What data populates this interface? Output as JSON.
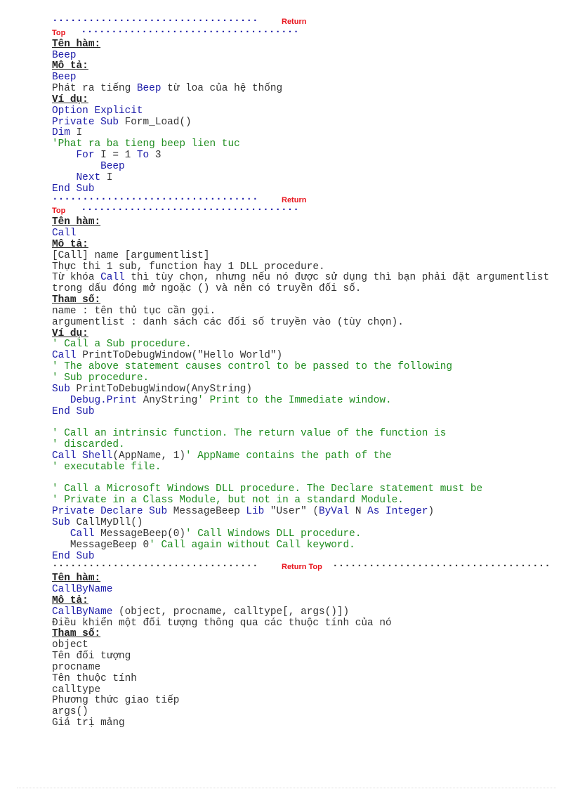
{
  "colors": {
    "keyword": "#1c1ca8",
    "comment": "#1e8c1e",
    "text": "#333333",
    "link": "#e8141c"
  },
  "lines": [
    {
      "type": "sep1",
      "dots": "..................................",
      "link": "Return"
    },
    {
      "type": "sep2",
      "link": "Top",
      "dots": "...................................."
    },
    {
      "segs": [
        {
          "t": "Tên hàm:",
          "c": "h"
        }
      ]
    },
    {
      "segs": [
        {
          "t": "Beep",
          "c": "k"
        }
      ]
    },
    {
      "segs": [
        {
          "t": "Mô tả:",
          "c": "h"
        }
      ]
    },
    {
      "segs": [
        {
          "t": "Beep",
          "c": "k"
        }
      ]
    },
    {
      "segs": [
        {
          "t": "Phát ra tiếng ",
          "c": "n"
        },
        {
          "t": "Beep",
          "c": "k"
        },
        {
          "t": " từ loa của hệ thống",
          "c": "n"
        }
      ]
    },
    {
      "segs": [
        {
          "t": "Ví dụ:",
          "c": "h"
        }
      ]
    },
    {
      "segs": [
        {
          "t": "Option Explicit",
          "c": "k"
        }
      ]
    },
    {
      "segs": [
        {
          "t": "Private Sub ",
          "c": "k"
        },
        {
          "t": "Form_Load()",
          "c": "n"
        }
      ]
    },
    {
      "segs": [
        {
          "t": "Dim ",
          "c": "k"
        },
        {
          "t": "I",
          "c": "n"
        }
      ]
    },
    {
      "segs": [
        {
          "t": "'Phat ra ba tieng beep lien tuc",
          "c": "g"
        }
      ]
    },
    {
      "indent": "    ",
      "segs": [
        {
          "t": "For ",
          "c": "k"
        },
        {
          "t": "I = 1 ",
          "c": "n"
        },
        {
          "t": "To ",
          "c": "k"
        },
        {
          "t": "3",
          "c": "n"
        }
      ]
    },
    {
      "indent": "        ",
      "segs": [
        {
          "t": "Beep",
          "c": "k"
        }
      ]
    },
    {
      "indent": "    ",
      "segs": [
        {
          "t": "Next ",
          "c": "k"
        },
        {
          "t": "I",
          "c": "n"
        }
      ]
    },
    {
      "segs": [
        {
          "t": "End Sub",
          "c": "k"
        }
      ]
    },
    {
      "type": "sep1",
      "dots": "..................................",
      "link": "Return"
    },
    {
      "type": "sep2",
      "link": "Top",
      "dots": "...................................."
    },
    {
      "segs": [
        {
          "t": "Tên hàm:",
          "c": "h"
        }
      ]
    },
    {
      "segs": [
        {
          "t": "Call",
          "c": "k"
        }
      ]
    },
    {
      "segs": [
        {
          "t": "Mô tả:",
          "c": "h"
        }
      ]
    },
    {
      "segs": [
        {
          "t": "[Call] name [argumentlist]",
          "c": "n"
        }
      ]
    },
    {
      "segs": [
        {
          "t": "Thực thi 1 sub, function hay 1 DLL procedure.",
          "c": "n"
        }
      ]
    },
    {
      "segs": [
        {
          "t": "Từ khóa ",
          "c": "n"
        },
        {
          "t": "Call",
          "c": "k"
        },
        {
          "t": " thì tùy chọn, nhưng nếu nó được sử dụng thì bạn phải đặt argumentlist",
          "c": "n"
        }
      ]
    },
    {
      "segs": [
        {
          "t": "trong dấu đóng mở ngoặc () và nên có truyền đối số.",
          "c": "n"
        }
      ]
    },
    {
      "segs": [
        {
          "t": "Tham số:",
          "c": "h"
        }
      ]
    },
    {
      "segs": [
        {
          "t": "name : tên thủ tục cần gọi.",
          "c": "n"
        }
      ]
    },
    {
      "segs": [
        {
          "t": "argumentlist : danh sách các đối số truyền vào (tùy chọn).",
          "c": "n"
        }
      ]
    },
    {
      "segs": [
        {
          "t": "Ví dụ:",
          "c": "h"
        }
      ]
    },
    {
      "segs": [
        {
          "t": "' Call a Sub procedure.",
          "c": "g"
        }
      ]
    },
    {
      "segs": [
        {
          "t": "Call ",
          "c": "k"
        },
        {
          "t": "PrintToDebugWindow(\"Hello World\")",
          "c": "n"
        }
      ]
    },
    {
      "segs": [
        {
          "t": "' The above statement causes control to be passed to the following",
          "c": "g"
        }
      ]
    },
    {
      "segs": [
        {
          "t": "' Sub procedure.",
          "c": "g"
        }
      ]
    },
    {
      "segs": [
        {
          "t": "Sub ",
          "c": "k"
        },
        {
          "t": "PrintToDebugWindow(AnyString)",
          "c": "n"
        }
      ]
    },
    {
      "indent": "   ",
      "segs": [
        {
          "t": "Debug.Print ",
          "c": "k"
        },
        {
          "t": "AnyString",
          "c": "n"
        },
        {
          "t": "' Print to the Immediate window.",
          "c": "g"
        }
      ]
    },
    {
      "segs": [
        {
          "t": "End Sub",
          "c": "k"
        }
      ]
    },
    {
      "segs": []
    },
    {
      "segs": [
        {
          "t": "' Call an intrinsic function. The return value of the function is",
          "c": "g"
        }
      ]
    },
    {
      "segs": [
        {
          "t": "' discarded.",
          "c": "g"
        }
      ]
    },
    {
      "segs": [
        {
          "t": "Call Shell",
          "c": "k"
        },
        {
          "t": "(AppName, 1)",
          "c": "n"
        },
        {
          "t": "' AppName contains the path of the",
          "c": "g"
        }
      ]
    },
    {
      "segs": [
        {
          "t": "' executable file.",
          "c": "g"
        }
      ]
    },
    {
      "segs": []
    },
    {
      "segs": [
        {
          "t": "' Call a Microsoft Windows DLL procedure. The Declare statement must be",
          "c": "g"
        }
      ]
    },
    {
      "segs": [
        {
          "t": "' Private in a Class Module, but not in a standard Module.",
          "c": "g"
        }
      ]
    },
    {
      "segs": [
        {
          "t": "Private Declare Sub ",
          "c": "k"
        },
        {
          "t": "MessageBeep ",
          "c": "n"
        },
        {
          "t": "Lib ",
          "c": "k"
        },
        {
          "t": "\"User\" (",
          "c": "n"
        },
        {
          "t": "ByVal ",
          "c": "k"
        },
        {
          "t": "N ",
          "c": "n"
        },
        {
          "t": "As Integer",
          "c": "k"
        },
        {
          "t": ")",
          "c": "n"
        }
      ]
    },
    {
      "segs": [
        {
          "t": "Sub ",
          "c": "k"
        },
        {
          "t": "CallMyDll()",
          "c": "n"
        }
      ]
    },
    {
      "indent": "   ",
      "segs": [
        {
          "t": "Call ",
          "c": "k"
        },
        {
          "t": "MessageBeep(0)",
          "c": "n"
        },
        {
          "t": "' Call Windows DLL procedure.",
          "c": "g"
        }
      ]
    },
    {
      "indent": "   ",
      "segs": [
        {
          "t": "MessageBeep 0",
          "c": "n"
        },
        {
          "t": "' Call again without Call keyword.",
          "c": "g"
        }
      ]
    },
    {
      "segs": [
        {
          "t": "End Sub",
          "c": "k"
        }
      ]
    },
    {
      "type": "sep3",
      "dots": "..................................",
      "link": "Return Top",
      "dots2": "...................................."
    },
    {
      "segs": [
        {
          "t": "Tên hàm:",
          "c": "h"
        }
      ]
    },
    {
      "segs": [
        {
          "t": "CallByName",
          "c": "k"
        }
      ]
    },
    {
      "segs": [
        {
          "t": "Mô tả:",
          "c": "h"
        }
      ]
    },
    {
      "segs": [
        {
          "t": "CallByName",
          "c": "k"
        },
        {
          "t": " (object, procname, calltype[, args()])",
          "c": "n"
        }
      ]
    },
    {
      "segs": [
        {
          "t": "Điều khiển một đối tượng thông qua các thuộc tính của nó",
          "c": "n"
        }
      ]
    },
    {
      "segs": [
        {
          "t": "Tham số:",
          "c": "h"
        }
      ]
    },
    {
      "segs": [
        {
          "t": "object",
          "c": "n"
        }
      ]
    },
    {
      "segs": [
        {
          "t": "Tên đối tượng",
          "c": "n"
        }
      ]
    },
    {
      "segs": [
        {
          "t": "procname",
          "c": "n"
        }
      ]
    },
    {
      "segs": [
        {
          "t": "Tên thuộc tính",
          "c": "n"
        }
      ]
    },
    {
      "segs": [
        {
          "t": "calltype",
          "c": "n"
        }
      ]
    },
    {
      "segs": [
        {
          "t": "Phương thức giao tiếp",
          "c": "n"
        }
      ]
    },
    {
      "segs": [
        {
          "t": "args()",
          "c": "n"
        }
      ]
    },
    {
      "segs": [
        {
          "t": "Giá trị mảng",
          "c": "n"
        }
      ]
    }
  ]
}
